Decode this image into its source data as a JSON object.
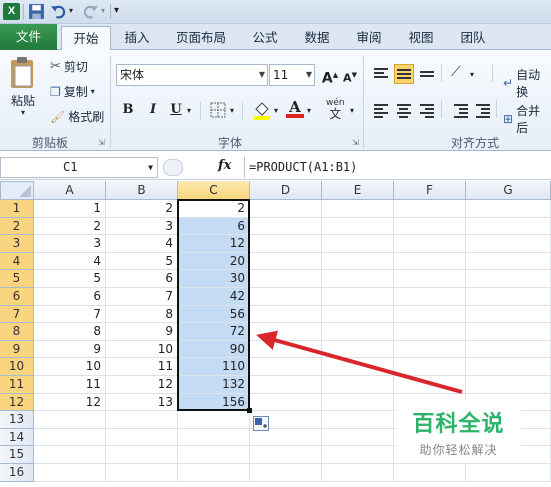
{
  "qat": {
    "logo": "X"
  },
  "tabs": [
    "文件",
    "开始",
    "插入",
    "页面布局",
    "公式",
    "数据",
    "审阅",
    "视图",
    "团队"
  ],
  "clipboard": {
    "paste": "粘贴",
    "cut": "剪切",
    "copy": "复制",
    "format_painter": "格式刷",
    "label": "剪贴板"
  },
  "font": {
    "name": "宋体",
    "size": "11",
    "label": "字体",
    "bold": "B",
    "italic": "I",
    "underline": "U",
    "grow": "A",
    "shrink": "A",
    "wen": "wén"
  },
  "alignment": {
    "label": "对齐方式",
    "wrap": "自动换",
    "merge": "合并后"
  },
  "namebox": {
    "value": "C1"
  },
  "formula_bar": {
    "fx": "fx",
    "formula": "=PRODUCT(A1:B1)"
  },
  "columns": [
    "A",
    "B",
    "C",
    "D",
    "E",
    "F",
    "G"
  ],
  "rows": [
    {
      "n": "1",
      "a": "1",
      "b": "2",
      "c": "2"
    },
    {
      "n": "2",
      "a": "2",
      "b": "3",
      "c": "6"
    },
    {
      "n": "3",
      "a": "3",
      "b": "4",
      "c": "12"
    },
    {
      "n": "4",
      "a": "4",
      "b": "5",
      "c": "20"
    },
    {
      "n": "5",
      "a": "5",
      "b": "6",
      "c": "30"
    },
    {
      "n": "6",
      "a": "6",
      "b": "7",
      "c": "42"
    },
    {
      "n": "7",
      "a": "7",
      "b": "8",
      "c": "56"
    },
    {
      "n": "8",
      "a": "8",
      "b": "9",
      "c": "72"
    },
    {
      "n": "9",
      "a": "9",
      "b": "10",
      "c": "90"
    },
    {
      "n": "10",
      "a": "10",
      "b": "11",
      "c": "110"
    },
    {
      "n": "11",
      "a": "11",
      "b": "12",
      "c": "132"
    },
    {
      "n": "12",
      "a": "12",
      "b": "13",
      "c": "156"
    },
    {
      "n": "13",
      "a": "",
      "b": "",
      "c": ""
    },
    {
      "n": "14",
      "a": "",
      "b": "",
      "c": ""
    },
    {
      "n": "15",
      "a": "",
      "b": "",
      "c": ""
    },
    {
      "n": "16",
      "a": "",
      "b": "",
      "c": ""
    }
  ],
  "watermark": {
    "title": "百科全说",
    "subtitle": "助你轻松解决"
  },
  "colors": {
    "accent": "#1f7a3d",
    "selection": "#c5daf3",
    "arrow": "#d9262b",
    "watermark": "#2bb36a"
  }
}
